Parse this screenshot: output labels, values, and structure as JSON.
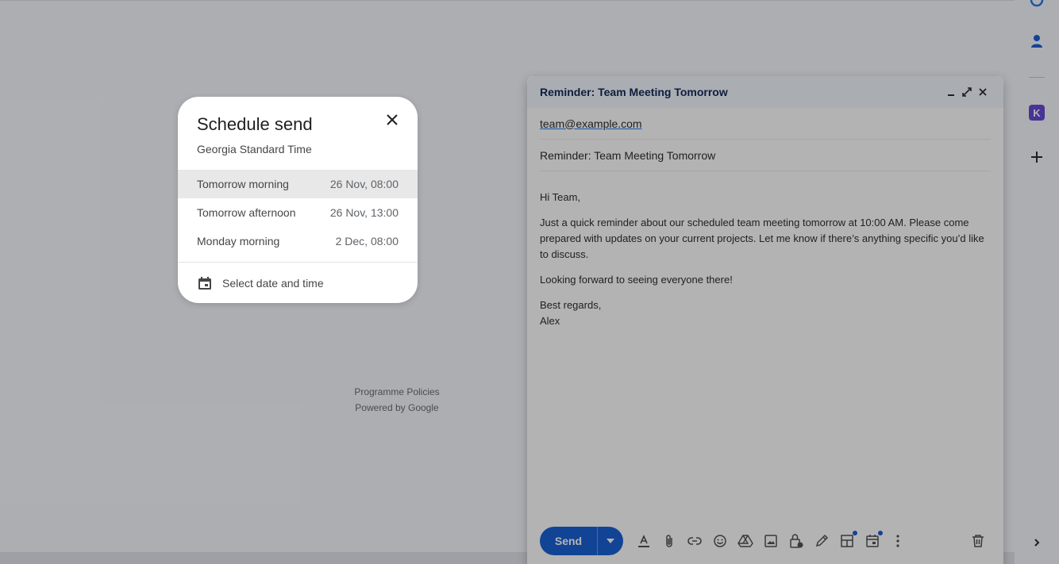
{
  "page": {
    "footer": {
      "policies": "Programme Policies",
      "powered_by": "Powered by Google"
    }
  },
  "side_panel": {
    "icons": [
      "circle-icon",
      "contacts-icon",
      "keep-k-icon",
      "add-icon",
      "chevron-right-icon"
    ],
    "keep_letter": "K"
  },
  "compose": {
    "title": "Reminder: Team Meeting Tomorrow",
    "recipient": "team@example.com",
    "subject": "Reminder: Team Meeting Tomorrow",
    "body": {
      "greeting": "Hi Team,",
      "paragraph": "Just a quick reminder about our scheduled team meeting tomorrow at 10:00 AM. Please come prepared with updates on your current projects. Let me know if there’s anything specific you’d like to discuss.",
      "closing_line": "Looking forward to seeing everyone there!",
      "sign_off": "Best regards,",
      "signature": "Alex"
    },
    "send_label": "Send",
    "toolbar_icons": [
      "text-format-icon",
      "attach-icon",
      "link-icon",
      "emoji-icon",
      "drive-icon",
      "photo-icon",
      "confidential-lock-icon",
      "signature-pen-icon",
      "layouts-icon",
      "schedule-calendar-icon",
      "more-options-icon",
      "discard-trash-icon"
    ]
  },
  "schedule_dialog": {
    "title": "Schedule send",
    "timezone": "Georgia Standard Time",
    "options": [
      {
        "label": "Tomorrow morning",
        "time": "26 Nov, 08:00",
        "selected": true
      },
      {
        "label": "Tomorrow afternoon",
        "time": "26 Nov, 13:00",
        "selected": false
      },
      {
        "label": "Monday morning",
        "time": "2 Dec, 08:00",
        "selected": false
      }
    ],
    "pick_label": "Select date and time"
  },
  "colors": {
    "accent": "#0b57d0",
    "header_bg": "#f2f6fc",
    "keep_purple": "#5b3fd0"
  }
}
